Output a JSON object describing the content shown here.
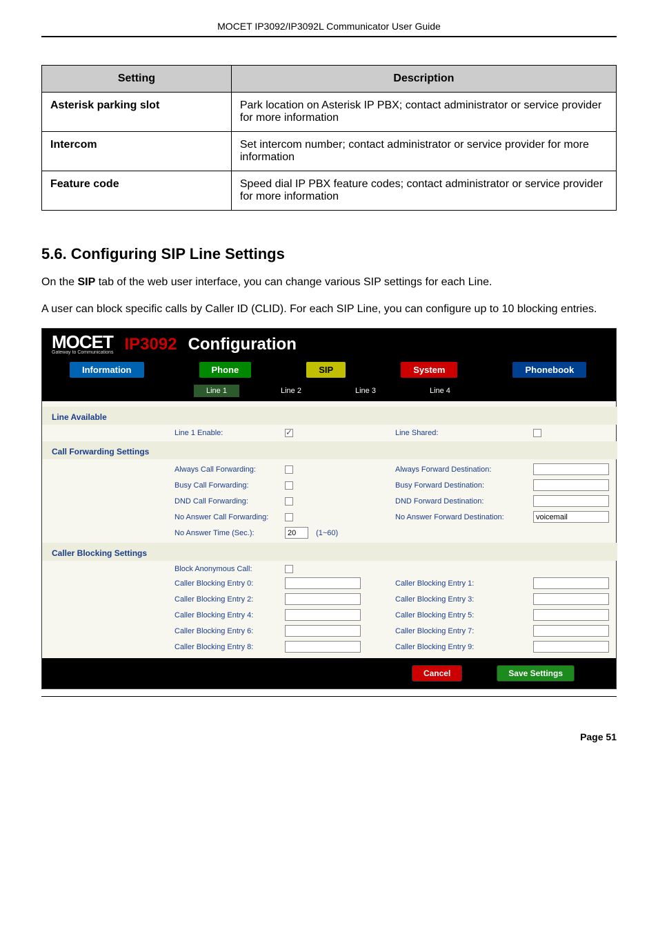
{
  "document_header": "MOCET IP3092/IP3092L Communicator User Guide",
  "table": {
    "headers": {
      "setting": "Setting",
      "description": "Description"
    },
    "rows": [
      {
        "setting": "Asterisk parking slot",
        "description": "Park location on Asterisk IP PBX; contact administrator or service provider for more information"
      },
      {
        "setting": "Intercom",
        "description": "Set intercom number; contact administrator or service provider for more information"
      },
      {
        "setting": "Feature code",
        "description": "Speed dial IP PBX feature codes; contact administrator or service provider for more information"
      }
    ]
  },
  "section": {
    "heading": "5.6. Configuring SIP Line Settings",
    "para1_a": "On the ",
    "para1_b": "SIP",
    "para1_c": " tab of the web user interface, you can change various SIP settings for each Line.",
    "para2": "A user can block specific calls by Caller ID (CLID). For each SIP Line, you can configure up to 10 blocking entries."
  },
  "config": {
    "brand": "MOCET",
    "brand_sub": "Gateway to Communications",
    "model": "IP3092",
    "title": "Configuration",
    "nav": {
      "information": "Information",
      "phone": "Phone",
      "sip": "SIP",
      "system": "System",
      "phonebook": "Phonebook"
    },
    "line_tabs": {
      "l1": "Line 1",
      "l2": "Line 2",
      "l3": "Line 3",
      "l4": "Line 4"
    },
    "sections": {
      "line_available": "Line Available",
      "call_forwarding": "Call Forwarding Settings",
      "caller_blocking": "Caller Blocking Settings"
    },
    "fields": {
      "line1_enable": "Line 1 Enable:",
      "line_shared": "Line Shared:",
      "always_cf": "Always Call Forwarding:",
      "always_fwd_dest": "Always Forward Destination:",
      "busy_cf": "Busy Call Forwarding:",
      "busy_fwd_dest": "Busy Forward Destination:",
      "dnd_cf": "DND Call Forwarding:",
      "dnd_fwd_dest": "DND Forward Destination:",
      "na_cf": "No Answer Call Forwarding:",
      "na_fwd_dest": "No Answer Forward Destination:",
      "na_time": "No Answer Time (Sec.):",
      "na_time_default": "20",
      "na_time_range": "(1~60)",
      "na_fwd_value": "voicemail",
      "block_anon": "Block Anonymous Call:",
      "cbe0": "Caller Blocking Entry 0:",
      "cbe1": "Caller Blocking Entry 1:",
      "cbe2": "Caller Blocking Entry 2:",
      "cbe3": "Caller Blocking Entry 3:",
      "cbe4": "Caller Blocking Entry 4:",
      "cbe5": "Caller Blocking Entry 5:",
      "cbe6": "Caller Blocking Entry 6:",
      "cbe7": "Caller Blocking Entry 7:",
      "cbe8": "Caller Blocking Entry 8:",
      "cbe9": "Caller Blocking Entry 9:"
    },
    "buttons": {
      "cancel": "Cancel",
      "save": "Save Settings"
    }
  },
  "page_number": "Page 51"
}
